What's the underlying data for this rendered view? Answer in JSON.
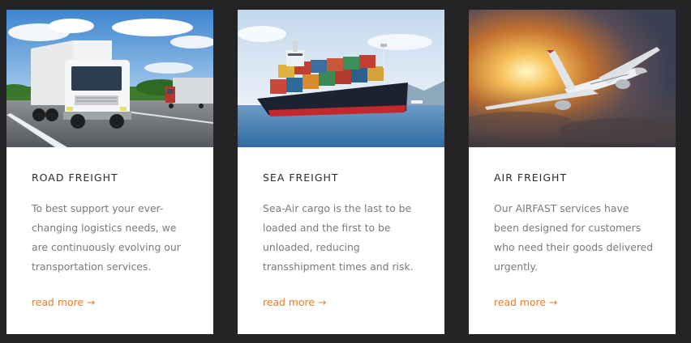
{
  "cards": [
    {
      "title": "ROAD FREIGHT",
      "image": "road-freight-truck-photo",
      "text_lines": [
        "To best support your ever-",
        "changing logistics needs, we",
        "are continuously evolving our",
        "transportation services."
      ],
      "link_label": "read more",
      "link_arrow": "→"
    },
    {
      "title": "SEA FREIGHT",
      "image": "sea-freight-container-ship-photo",
      "text_lines": [
        "Sea-Air cargo is the last to be",
        "loaded and the first to be",
        "unloaded, reducing",
        "transshipment times and risk."
      ],
      "link_label": "read more",
      "link_arrow": "→"
    },
    {
      "title": "AIR FREIGHT",
      "image": "air-freight-airplane-photo",
      "text_lines": [
        "Our AIRFAST services have",
        "been designed for customers",
        "who need their goods delivered",
        "urgently."
      ],
      "link_label": "read more",
      "link_arrow": "→"
    }
  ],
  "colors": {
    "page_background": "#242427",
    "card_background": "#ffffff",
    "title": "#2b2b2b",
    "body_text": "#7a7a7a",
    "link": "#ee7b22"
  }
}
